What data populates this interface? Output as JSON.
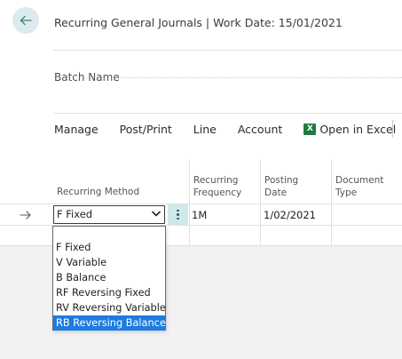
{
  "header": {
    "title": "Recurring General Journals | Work Date: 15/01/2021"
  },
  "batch": {
    "label": "Batch Name"
  },
  "actions": [
    {
      "label": "Manage"
    },
    {
      "label": "Post/Print"
    },
    {
      "label": "Line"
    },
    {
      "label": "Account"
    },
    {
      "label": "Open in Excel",
      "icon": "excel-icon"
    }
  ],
  "columns": {
    "recurring_method": "Recurring Method",
    "recurring_frequency_1": "Recurring",
    "recurring_frequency_2": "Frequency",
    "posting_date_1": "Posting",
    "posting_date_2": "Date",
    "document_type_1": "Document",
    "document_type_2": "Type"
  },
  "row": {
    "recurring_method": "F Fixed",
    "recurring_frequency": "1M",
    "posting_date": "1/02/2021",
    "document_type": ""
  },
  "dropdown": {
    "options": [
      "F Fixed",
      "V Variable",
      "B Balance",
      "RF Reversing Fixed",
      "RV Reversing Variable",
      "RB Reversing Balance"
    ],
    "highlighted_index": 5
  },
  "colors": {
    "accent": "#1e7be0",
    "back_button_bg": "#dcebec",
    "kebab_bg": "#cfe8ec",
    "excel_green": "#1f7a3e"
  }
}
